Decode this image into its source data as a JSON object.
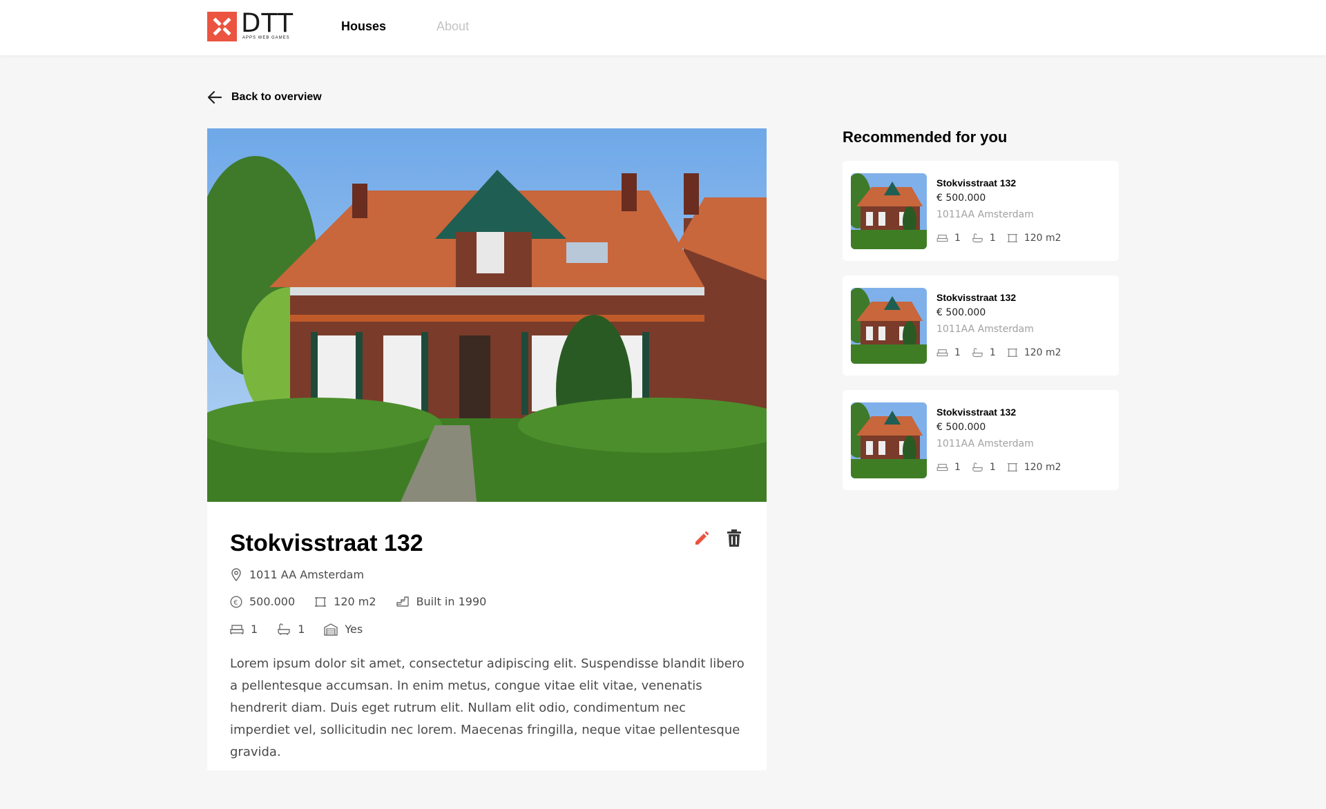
{
  "header": {
    "logo_word": "DTT",
    "logo_sub": "APPS WEB GAMES",
    "nav": [
      {
        "label": "Houses",
        "active": true
      },
      {
        "label": "About",
        "active": false
      }
    ]
  },
  "back_label": "Back to overview",
  "house": {
    "title": "Stokvisstraat 132",
    "address": "1011 AA Amsterdam",
    "price": "500.000",
    "size": "120 m2",
    "built": "Built in 1990",
    "bedrooms": "1",
    "bathrooms": "1",
    "garage": "Yes",
    "description": "Lorem ipsum dolor sit amet, consectetur adipiscing elit. Suspendisse blandit libero a pellentesque accumsan. In enim metus, congue vitae elit vitae, venenatis hendrerit diam. Duis eget rutrum elit. Nullam elit odio, condimentum nec imperdiet vel, sollicitudin nec lorem. Maecenas fringilla, neque vitae pellentesque gravida."
  },
  "recommended": {
    "title": "Recommended for you",
    "items": [
      {
        "street": "Stokvisstraat 132",
        "price": "€ 500.000",
        "city": "1011AA Amsterdam",
        "bedrooms": "1",
        "bathrooms": "1",
        "size": "120 m2"
      },
      {
        "street": "Stokvisstraat 132",
        "price": "€ 500.000",
        "city": "1011AA Amsterdam",
        "bedrooms": "1",
        "bathrooms": "1",
        "size": "120 m2"
      },
      {
        "street": "Stokvisstraat 132",
        "price": "€ 500.000",
        "city": "1011AA Amsterdam",
        "bedrooms": "1",
        "bathrooms": "1",
        "size": "120 m2"
      }
    ]
  },
  "colors": {
    "accent": "#eb5440",
    "background": "#f6f6f6",
    "text_secondary": "#4a4a4a"
  },
  "icons": [
    "back-arrow-icon",
    "edit-icon",
    "trash-icon",
    "location-pin-icon",
    "euro-icon",
    "size-icon",
    "built-icon",
    "bed-icon",
    "bath-icon",
    "garage-icon"
  ]
}
